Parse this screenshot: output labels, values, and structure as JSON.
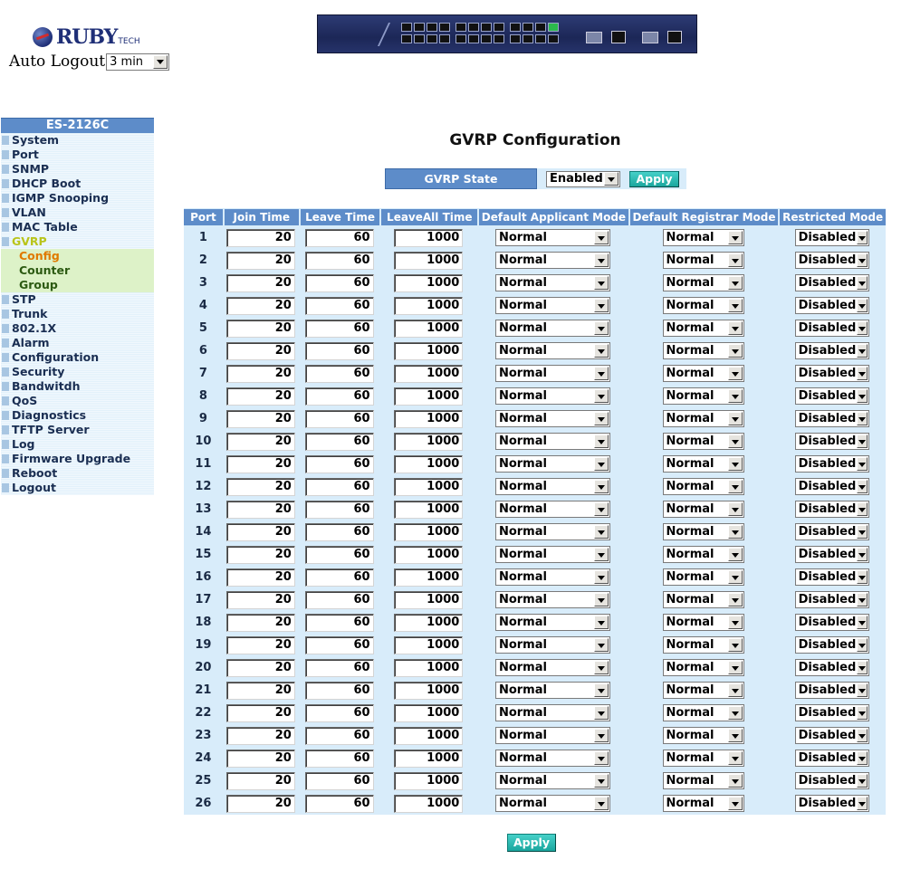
{
  "header": {
    "logo_text": "RUBY",
    "logo_suffix": "TECH",
    "auto_logout_label": "Auto Logout",
    "auto_logout_value": "3 min"
  },
  "sidebar": {
    "model": "ES-2126C",
    "items": [
      "System",
      "Port",
      "SNMP",
      "DHCP Boot",
      "IGMP Snooping",
      "VLAN",
      "MAC Table",
      "GVRP",
      "Config",
      "Counter",
      "Group",
      "STP",
      "Trunk",
      "802.1X",
      "Alarm",
      "Configuration",
      "Security",
      "Bandwitdh",
      "QoS",
      "Diagnostics",
      "TFTP Server",
      "Log",
      "Firmware Upgrade",
      "Reboot",
      "Logout"
    ],
    "active_parent": "GVRP",
    "sub_items": [
      "Config",
      "Counter",
      "Group"
    ],
    "current": "Config"
  },
  "main": {
    "title": "GVRP Configuration",
    "gvrp_state_label": "GVRP State",
    "gvrp_state_value": "Enabled",
    "apply_label": "Apply"
  },
  "table": {
    "columns": [
      "Port",
      "Join Time",
      "Leave Time",
      "LeaveAll Time",
      "Default Applicant Mode",
      "Default Registrar Mode",
      "Restricted Mode"
    ],
    "rows": [
      {
        "port": "1",
        "join": "20",
        "leave": "60",
        "leaveall": "1000",
        "applicant": "Normal",
        "registrar": "Normal",
        "restricted": "Disabled"
      },
      {
        "port": "2",
        "join": "20",
        "leave": "60",
        "leaveall": "1000",
        "applicant": "Normal",
        "registrar": "Normal",
        "restricted": "Disabled"
      },
      {
        "port": "3",
        "join": "20",
        "leave": "60",
        "leaveall": "1000",
        "applicant": "Normal",
        "registrar": "Normal",
        "restricted": "Disabled"
      },
      {
        "port": "4",
        "join": "20",
        "leave": "60",
        "leaveall": "1000",
        "applicant": "Normal",
        "registrar": "Normal",
        "restricted": "Disabled"
      },
      {
        "port": "5",
        "join": "20",
        "leave": "60",
        "leaveall": "1000",
        "applicant": "Normal",
        "registrar": "Normal",
        "restricted": "Disabled"
      },
      {
        "port": "6",
        "join": "20",
        "leave": "60",
        "leaveall": "1000",
        "applicant": "Normal",
        "registrar": "Normal",
        "restricted": "Disabled"
      },
      {
        "port": "7",
        "join": "20",
        "leave": "60",
        "leaveall": "1000",
        "applicant": "Normal",
        "registrar": "Normal",
        "restricted": "Disabled"
      },
      {
        "port": "8",
        "join": "20",
        "leave": "60",
        "leaveall": "1000",
        "applicant": "Normal",
        "registrar": "Normal",
        "restricted": "Disabled"
      },
      {
        "port": "9",
        "join": "20",
        "leave": "60",
        "leaveall": "1000",
        "applicant": "Normal",
        "registrar": "Normal",
        "restricted": "Disabled"
      },
      {
        "port": "10",
        "join": "20",
        "leave": "60",
        "leaveall": "1000",
        "applicant": "Normal",
        "registrar": "Normal",
        "restricted": "Disabled"
      },
      {
        "port": "11",
        "join": "20",
        "leave": "60",
        "leaveall": "1000",
        "applicant": "Normal",
        "registrar": "Normal",
        "restricted": "Disabled"
      },
      {
        "port": "12",
        "join": "20",
        "leave": "60",
        "leaveall": "1000",
        "applicant": "Normal",
        "registrar": "Normal",
        "restricted": "Disabled"
      },
      {
        "port": "13",
        "join": "20",
        "leave": "60",
        "leaveall": "1000",
        "applicant": "Normal",
        "registrar": "Normal",
        "restricted": "Disabled"
      },
      {
        "port": "14",
        "join": "20",
        "leave": "60",
        "leaveall": "1000",
        "applicant": "Normal",
        "registrar": "Normal",
        "restricted": "Disabled"
      },
      {
        "port": "15",
        "join": "20",
        "leave": "60",
        "leaveall": "1000",
        "applicant": "Normal",
        "registrar": "Normal",
        "restricted": "Disabled"
      },
      {
        "port": "16",
        "join": "20",
        "leave": "60",
        "leaveall": "1000",
        "applicant": "Normal",
        "registrar": "Normal",
        "restricted": "Disabled"
      },
      {
        "port": "17",
        "join": "20",
        "leave": "60",
        "leaveall": "1000",
        "applicant": "Normal",
        "registrar": "Normal",
        "restricted": "Disabled"
      },
      {
        "port": "18",
        "join": "20",
        "leave": "60",
        "leaveall": "1000",
        "applicant": "Normal",
        "registrar": "Normal",
        "restricted": "Disabled"
      },
      {
        "port": "19",
        "join": "20",
        "leave": "60",
        "leaveall": "1000",
        "applicant": "Normal",
        "registrar": "Normal",
        "restricted": "Disabled"
      },
      {
        "port": "20",
        "join": "20",
        "leave": "60",
        "leaveall": "1000",
        "applicant": "Normal",
        "registrar": "Normal",
        "restricted": "Disabled"
      },
      {
        "port": "21",
        "join": "20",
        "leave": "60",
        "leaveall": "1000",
        "applicant": "Normal",
        "registrar": "Normal",
        "restricted": "Disabled"
      },
      {
        "port": "22",
        "join": "20",
        "leave": "60",
        "leaveall": "1000",
        "applicant": "Normal",
        "registrar": "Normal",
        "restricted": "Disabled"
      },
      {
        "port": "23",
        "join": "20",
        "leave": "60",
        "leaveall": "1000",
        "applicant": "Normal",
        "registrar": "Normal",
        "restricted": "Disabled"
      },
      {
        "port": "24",
        "join": "20",
        "leave": "60",
        "leaveall": "1000",
        "applicant": "Normal",
        "registrar": "Normal",
        "restricted": "Disabled"
      },
      {
        "port": "25",
        "join": "20",
        "leave": "60",
        "leaveall": "1000",
        "applicant": "Normal",
        "registrar": "Normal",
        "restricted": "Disabled"
      },
      {
        "port": "26",
        "join": "20",
        "leave": "60",
        "leaveall": "1000",
        "applicant": "Normal",
        "registrar": "Normal",
        "restricted": "Disabled"
      }
    ]
  },
  "colors": {
    "header_blue": "#5d8cc9",
    "row_bg": "#d8ecfa",
    "apply_teal": "#1aa69e",
    "active_nav": "#b9c41a",
    "current_sub": "#e07a00"
  },
  "icons": [
    "ruby-tech-logo-icon",
    "switch-front-panel-image",
    "dropdown-arrow-icon",
    "nav-bullet-icon"
  ]
}
